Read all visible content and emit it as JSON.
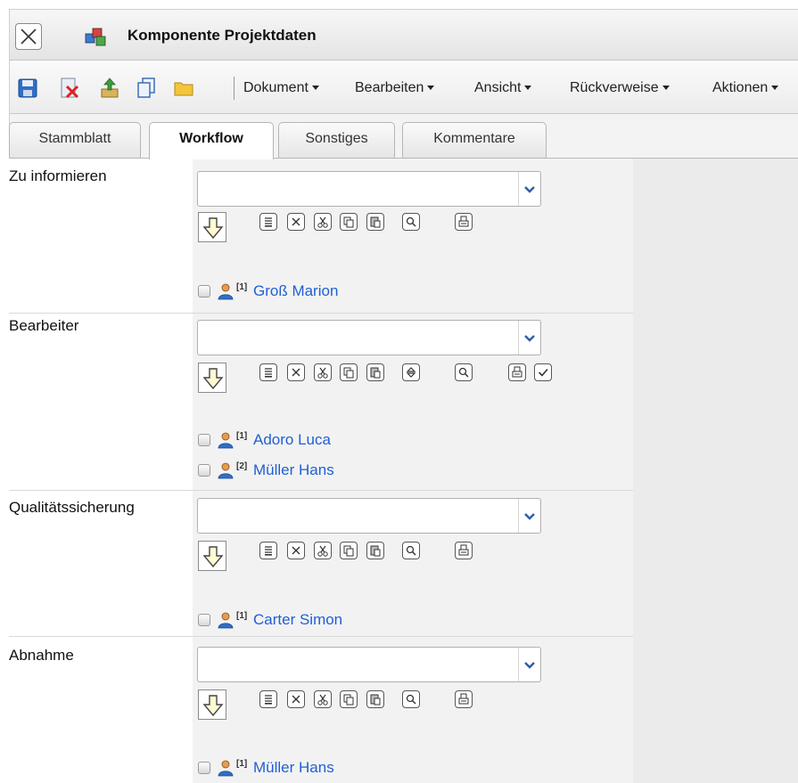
{
  "window": {
    "title": "Komponente Projektdaten"
  },
  "toolbar": {
    "icons": [
      "save-icon",
      "delete-icon",
      "export-icon",
      "copy-icon",
      "folder-icon"
    ],
    "menus": [
      {
        "label": "Dokument"
      },
      {
        "label": "Bearbeiten"
      },
      {
        "label": "Ansicht"
      },
      {
        "label": "Rückverweise"
      },
      {
        "label": "Aktionen"
      }
    ]
  },
  "tabs": [
    {
      "label": "Stammblatt",
      "active": false
    },
    {
      "label": "Workflow",
      "active": true
    },
    {
      "label": "Sonstiges",
      "active": false
    },
    {
      "label": "Kommentare",
      "active": false
    }
  ],
  "sections": [
    {
      "label": "Zu informieren",
      "combo_value": "",
      "buttons": [
        "list-icon",
        "remove-icon",
        "cut-icon",
        "copy-icon",
        "paste-icon",
        "search-icon",
        "print-icon"
      ],
      "people": [
        {
          "index": "[1]",
          "name": "Groß Marion"
        }
      ]
    },
    {
      "label": "Bearbeiter",
      "combo_value": "",
      "buttons": [
        "list-icon",
        "remove-icon",
        "cut-icon",
        "copy-icon",
        "paste-icon",
        "sort-icon",
        "search-icon",
        "print-icon",
        "check-icon"
      ],
      "people": [
        {
          "index": "[1]",
          "name": "Adoro Luca"
        },
        {
          "index": "[2]",
          "name": "Müller Hans"
        }
      ]
    },
    {
      "label": "Qualitätssicherung",
      "combo_value": "",
      "buttons": [
        "list-icon",
        "remove-icon",
        "cut-icon",
        "copy-icon",
        "paste-icon",
        "search-icon",
        "print-icon"
      ],
      "people": [
        {
          "index": "[1]",
          "name": "Carter Simon"
        }
      ]
    },
    {
      "label": "Abnahme",
      "combo_value": "",
      "buttons": [
        "list-icon",
        "remove-icon",
        "cut-icon",
        "copy-icon",
        "paste-icon",
        "search-icon",
        "print-icon"
      ],
      "people": [
        {
          "index": "[1]",
          "name": "Müller Hans"
        }
      ]
    }
  ],
  "colors": {
    "link": "#1f5fd6",
    "panel": "#f2f2f2",
    "right_panel": "#ebebeb"
  }
}
